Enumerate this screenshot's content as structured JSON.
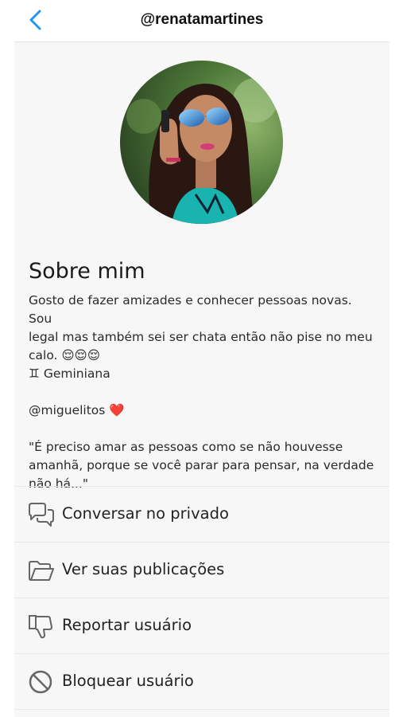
{
  "header": {
    "title": "@renatamartines"
  },
  "profile": {
    "about_title": "Sobre mim",
    "bio_lines": [
      "Gosto de fazer amizades e conhecer pessoas novas. Sou",
      "legal mas também sei ser chata então não pise no meu",
      "calo. 😌😌😌",
      "♊ Geminiana",
      "",
      "@miguelitos ❤️",
      "",
      "\"É preciso amar as pessoas como se não houvesse",
      "amanhã, porque se você parar para pensar, na verdade",
      "não há...\""
    ]
  },
  "menu": {
    "items": [
      {
        "label": "Conversar no privado",
        "icon": "chat-bubbles-icon"
      },
      {
        "label": "Ver suas publicações",
        "icon": "folder-icon"
      },
      {
        "label": "Reportar usuário",
        "icon": "thumbs-down-icon"
      },
      {
        "label": "Bloquear usuário",
        "icon": "block-icon"
      }
    ]
  },
  "colors": {
    "accent": "#2196f3",
    "background": "#f7f7f7",
    "divider": "#e6e6e6",
    "icon": "#666666"
  }
}
